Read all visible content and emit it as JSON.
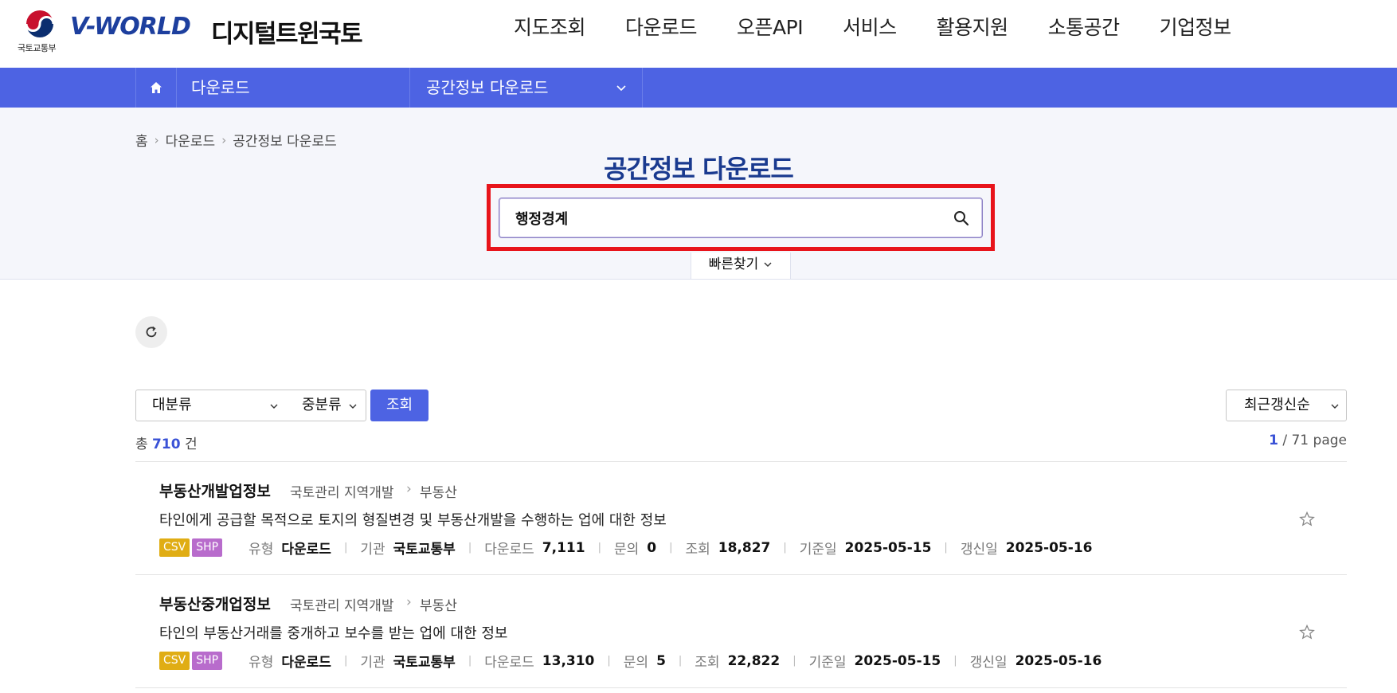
{
  "header": {
    "ministry_label": "국토교통부",
    "brand": "V-WORLD",
    "brand_sub": "디지털트윈국토",
    "nav": [
      "지도조회",
      "다운로드",
      "오픈API",
      "서비스",
      "활용지원",
      "소통공간",
      "기업정보"
    ]
  },
  "subbar": {
    "depth1": "다운로드",
    "depth2": "공간정보 다운로드"
  },
  "breadcrumb": [
    "홈",
    "다운로드",
    "공간정보 다운로드"
  ],
  "page_title": "공간정보 다운로드",
  "search": {
    "value": "행정경계"
  },
  "quick_tab": "빠른찾기",
  "filters": {
    "category_major": "대분류",
    "category_minor": "중분류",
    "search_button": "조회",
    "sort": "최근갱신순"
  },
  "summary": {
    "total_prefix": "총",
    "total_count": "710",
    "total_suffix": "건",
    "page_current": "1",
    "page_rest": "/ 71 page"
  },
  "results": [
    {
      "title": "부동산개발업정보",
      "category": "국토관리 지역개발",
      "subcategory": "부동산",
      "description": "타인에게 공급할 목적으로 토지의 형질변경 및 부동산개발을 수행하는 업에 대한 정보",
      "tags": [
        "CSV",
        "SHP"
      ],
      "meta": [
        {
          "label": "유형",
          "value": "다운로드"
        },
        {
          "label": "기관",
          "value": "국토교통부"
        },
        {
          "label": "다운로드",
          "value": "7,111"
        },
        {
          "label": "문의",
          "value": "0"
        },
        {
          "label": "조회",
          "value": "18,827"
        },
        {
          "label": "기준일",
          "value": "2025-05-15"
        },
        {
          "label": "갱신일",
          "value": "2025-05-16"
        }
      ]
    },
    {
      "title": "부동산중개업정보",
      "category": "국토관리 지역개발",
      "subcategory": "부동산",
      "description": "타인의 부동산거래를 중개하고 보수를 받는 업에 대한 정보",
      "tags": [
        "CSV",
        "SHP"
      ],
      "meta": [
        {
          "label": "유형",
          "value": "다운로드"
        },
        {
          "label": "기관",
          "value": "국토교통부"
        },
        {
          "label": "다운로드",
          "value": "13,310"
        },
        {
          "label": "문의",
          "value": "5"
        },
        {
          "label": "조회",
          "value": "22,822"
        },
        {
          "label": "기준일",
          "value": "2025-05-15"
        },
        {
          "label": "갱신일",
          "value": "2025-05-16"
        }
      ]
    }
  ],
  "colors": {
    "brand_blue": "#1d3f9e",
    "subbar_blue": "#4d63e3",
    "highlight_red": "#e8141b",
    "tag_csv": "#e0ad14",
    "tag_shp": "#b86ccc"
  }
}
